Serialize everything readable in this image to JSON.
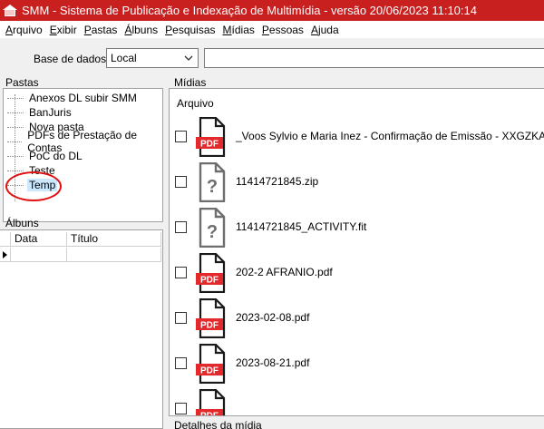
{
  "window": {
    "title": "SMM - Sistema de Publicação e Indexação de Multimídia - versão 20/06/2023 11:10:14"
  },
  "menu": [
    {
      "first": "A",
      "rest": "rquivo"
    },
    {
      "first": "E",
      "rest": "xibir"
    },
    {
      "first": "P",
      "rest": "astas"
    },
    {
      "first": "Á",
      "rest": "lbuns"
    },
    {
      "first": "P",
      "rest": "esquisas"
    },
    {
      "first": "M",
      "rest": "ídias"
    },
    {
      "first": "P",
      "rest": "essoas"
    },
    {
      "first": "A",
      "rest": "juda"
    }
  ],
  "database": {
    "label": "Base de dados:",
    "selected": "Local",
    "search_value": ""
  },
  "folders": {
    "title": "Pastas",
    "items": [
      "Anexos DL subir SMM",
      "BanJuris",
      "Nova pasta",
      "PDFs de Prestação de Contas",
      "PoC do DL",
      "Teste",
      "Temp"
    ],
    "selected": "Temp"
  },
  "albums": {
    "title": "Álbuns",
    "columns": [
      "Data",
      "Título"
    ]
  },
  "media": {
    "title": "Mídias",
    "column_header": "Arquivo",
    "items": [
      {
        "name": "_Voos Sylvio e Maria Inez - Confirmação de Emissão - XXGZKA.pdf",
        "type": "pdf",
        "checked": false
      },
      {
        "name": "11414721845.zip",
        "type": "unknown",
        "checked": false
      },
      {
        "name": "11414721845_ACTIVITY.fit",
        "type": "unknown",
        "checked": false
      },
      {
        "name": "202-2 AFRANIO.pdf",
        "type": "pdf",
        "checked": false
      },
      {
        "name": "2023-02-08.pdf",
        "type": "pdf",
        "checked": false
      },
      {
        "name": "2023-08-21.pdf",
        "type": "pdf",
        "checked": false
      },
      {
        "name": "",
        "type": "pdf",
        "checked": false
      }
    ]
  },
  "details": {
    "title": "Detalhes da mídia"
  },
  "icons": {
    "pdf_label": "PDF",
    "unknown_label": "?",
    "pdf_color": "#e3292b"
  },
  "colors": {
    "titlebar": "#c81f1f",
    "selection": "#cce8ff",
    "annotation_ring": "#e01010"
  }
}
